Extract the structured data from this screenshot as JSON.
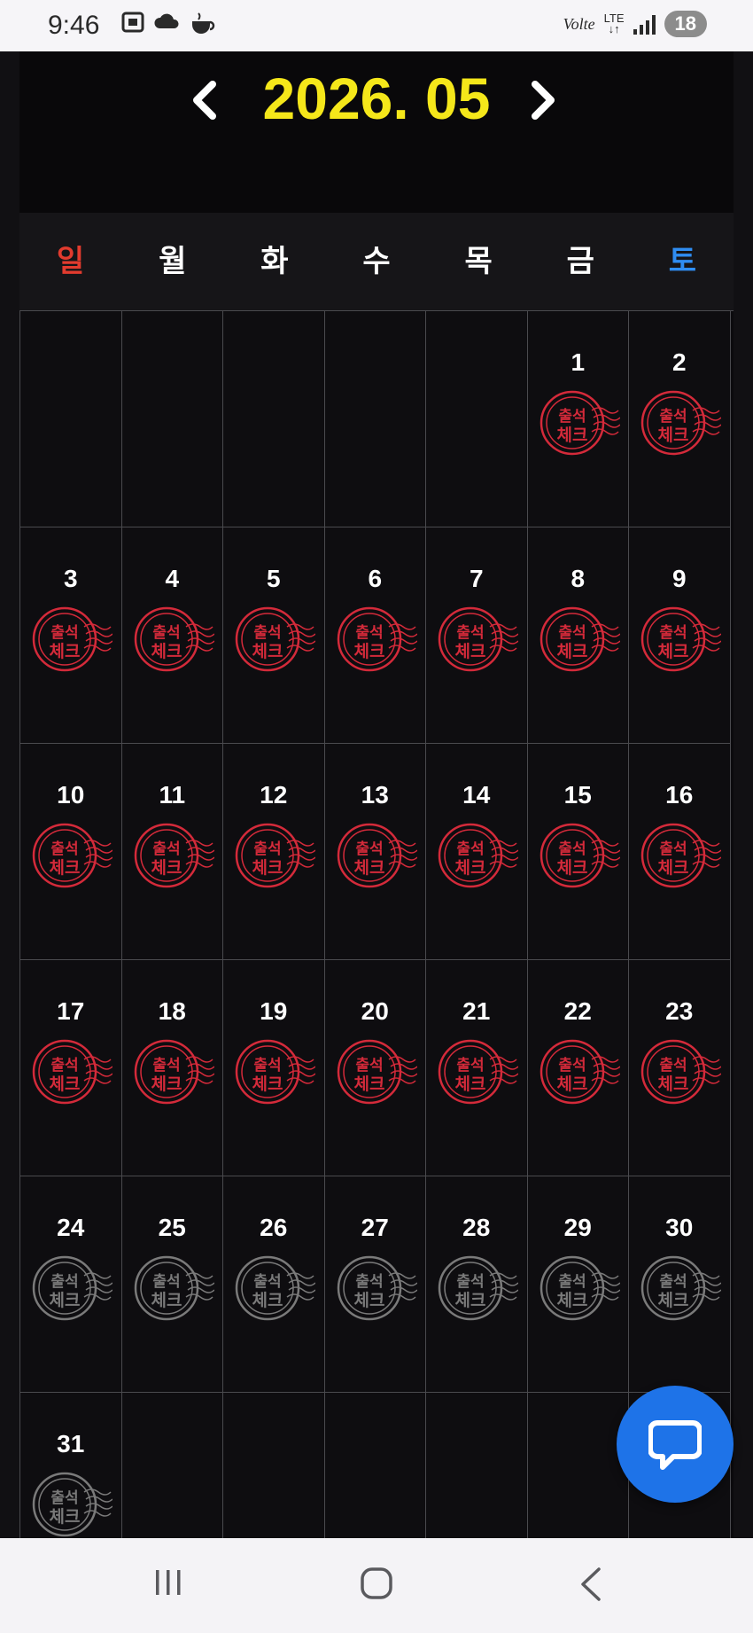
{
  "status_bar": {
    "time": "9:46",
    "volte": "Volte",
    "lte": "LTE",
    "battery": "18"
  },
  "calendar": {
    "title": "2026. 05",
    "prev_label": "‹",
    "next_label": "›",
    "weekdays": [
      "일",
      "월",
      "화",
      "수",
      "목",
      "금",
      "토"
    ],
    "stamp_text_top": "출석",
    "stamp_text_bottom": "체크",
    "first_weekday_index": 5,
    "days_in_month": 31,
    "checked_days": [
      1,
      2,
      3,
      4,
      5,
      6,
      7,
      8,
      9,
      10,
      11,
      12,
      13,
      14,
      15,
      16,
      17,
      18,
      19,
      20,
      21,
      22,
      23
    ],
    "colors": {
      "stamp_checked": "#d42a3a",
      "stamp_unchecked": "#7a7a7a",
      "title": "#f5e71a",
      "sunday": "#e23b2e",
      "saturday": "#2f8df2"
    }
  },
  "chat_button": {
    "icon": "chat-bubble-icon"
  },
  "navbar": {
    "recents_icon": "recents-icon",
    "home_icon": "home-icon",
    "back_icon": "back-icon"
  }
}
